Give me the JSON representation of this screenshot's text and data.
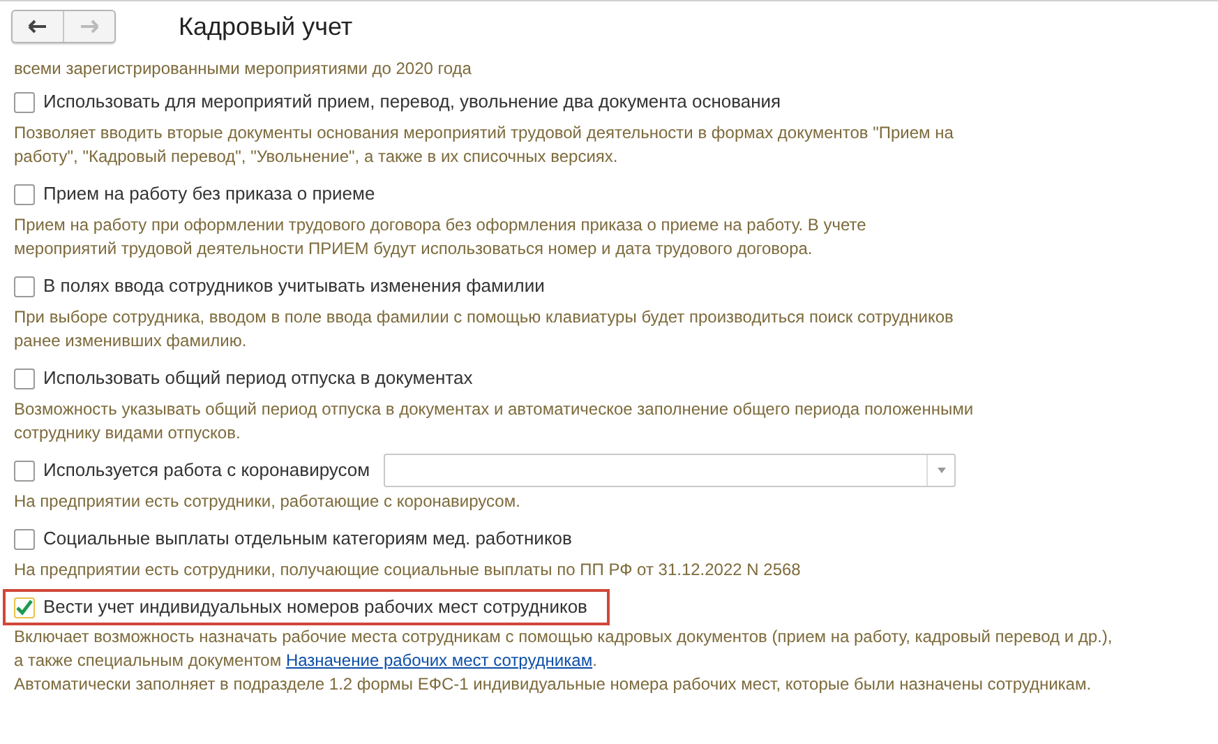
{
  "nav": {
    "back_disabled": false,
    "forward_disabled": true
  },
  "title": "Кадровый учет",
  "intro": [
    "всеми зарегистрированными мероприятиями до 2020 года"
  ],
  "options": [
    {
      "kind": "checkbox",
      "label": "Использовать для мероприятий прием, перевод, увольнение два документа основания",
      "checked": false,
      "highlighted": false,
      "description": [
        [
          {
            "kind": "text",
            "text": "Позволяет вводить вторые документы основания мероприятий трудовой деятельности в формах документов \"Прием на"
          }
        ],
        [
          {
            "kind": "text",
            "text": "работу\", \"Кадровый перевод\", \"Увольнение\", а также в их списочных версиях."
          }
        ]
      ]
    },
    {
      "kind": "checkbox",
      "label": "Прием на работу без приказа о приеме",
      "checked": false,
      "highlighted": false,
      "description": [
        [
          {
            "kind": "text",
            "text": "Прием на работу при оформлении трудового договора без оформления приказа о приеме на работу. В учете"
          }
        ],
        [
          {
            "kind": "text",
            "text": "мероприятий трудовой деятельности ПРИЕМ будут использоваться номер и дата трудового договора."
          }
        ]
      ]
    },
    {
      "kind": "checkbox",
      "label": "В полях ввода сотрудников учитывать изменения фамилии",
      "checked": false,
      "highlighted": false,
      "description": [
        [
          {
            "kind": "text",
            "text": "При выборе сотрудника, вводом в поле ввода фамилии с помощью клавиатуры будет производиться поиск сотрудников"
          }
        ],
        [
          {
            "kind": "text",
            "text": "ранее изменивших фамилию."
          }
        ]
      ]
    },
    {
      "kind": "checkbox",
      "label": "Использовать общий период отпуска в документах",
      "checked": false,
      "highlighted": false,
      "description": [
        [
          {
            "kind": "text",
            "text": "Возможность указывать общий период отпуска в документах и автоматическое заполнение общего периода положенными"
          }
        ],
        [
          {
            "kind": "text",
            "text": "сотруднику видами отпусков."
          }
        ]
      ]
    },
    {
      "kind": "checkbox_combo",
      "label": "Используется работа с коронавирусом",
      "checked": false,
      "highlighted": false,
      "description": [
        [
          {
            "kind": "text",
            "text": "На предприятии есть сотрудники, работающие с коронавирусом."
          }
        ]
      ]
    },
    {
      "kind": "checkbox",
      "label": "Социальные выплаты отдельным категориям мед. работников",
      "checked": false,
      "highlighted": false,
      "description": [
        [
          {
            "kind": "text",
            "text": "На предприятии есть сотрудники, получающие социальные выплаты по ПП РФ от 31.12.2022 N 2568"
          }
        ]
      ]
    },
    {
      "kind": "checkbox",
      "label": "Вести учет индивидуальных номеров рабочих мест сотрудников",
      "checked": true,
      "highlighted": true,
      "description": [
        [
          {
            "kind": "text",
            "text": "Включает возможность назначать рабочие места сотрудникам с помощью кадровых документов (прием на работу, кадровый перевод и др.),"
          }
        ],
        [
          {
            "kind": "text",
            "text": "а также специальным документом "
          },
          {
            "kind": "link",
            "text": "Назначение рабочих мест сотрудникам"
          },
          {
            "kind": "text",
            "text": "."
          }
        ],
        [
          {
            "kind": "text",
            "text": "Автоматически заполняет в подразделе 1.2 формы ЕФС-1 индивидуальные номера рабочих мест, которые были назначены сотрудникам."
          }
        ]
      ]
    }
  ]
}
